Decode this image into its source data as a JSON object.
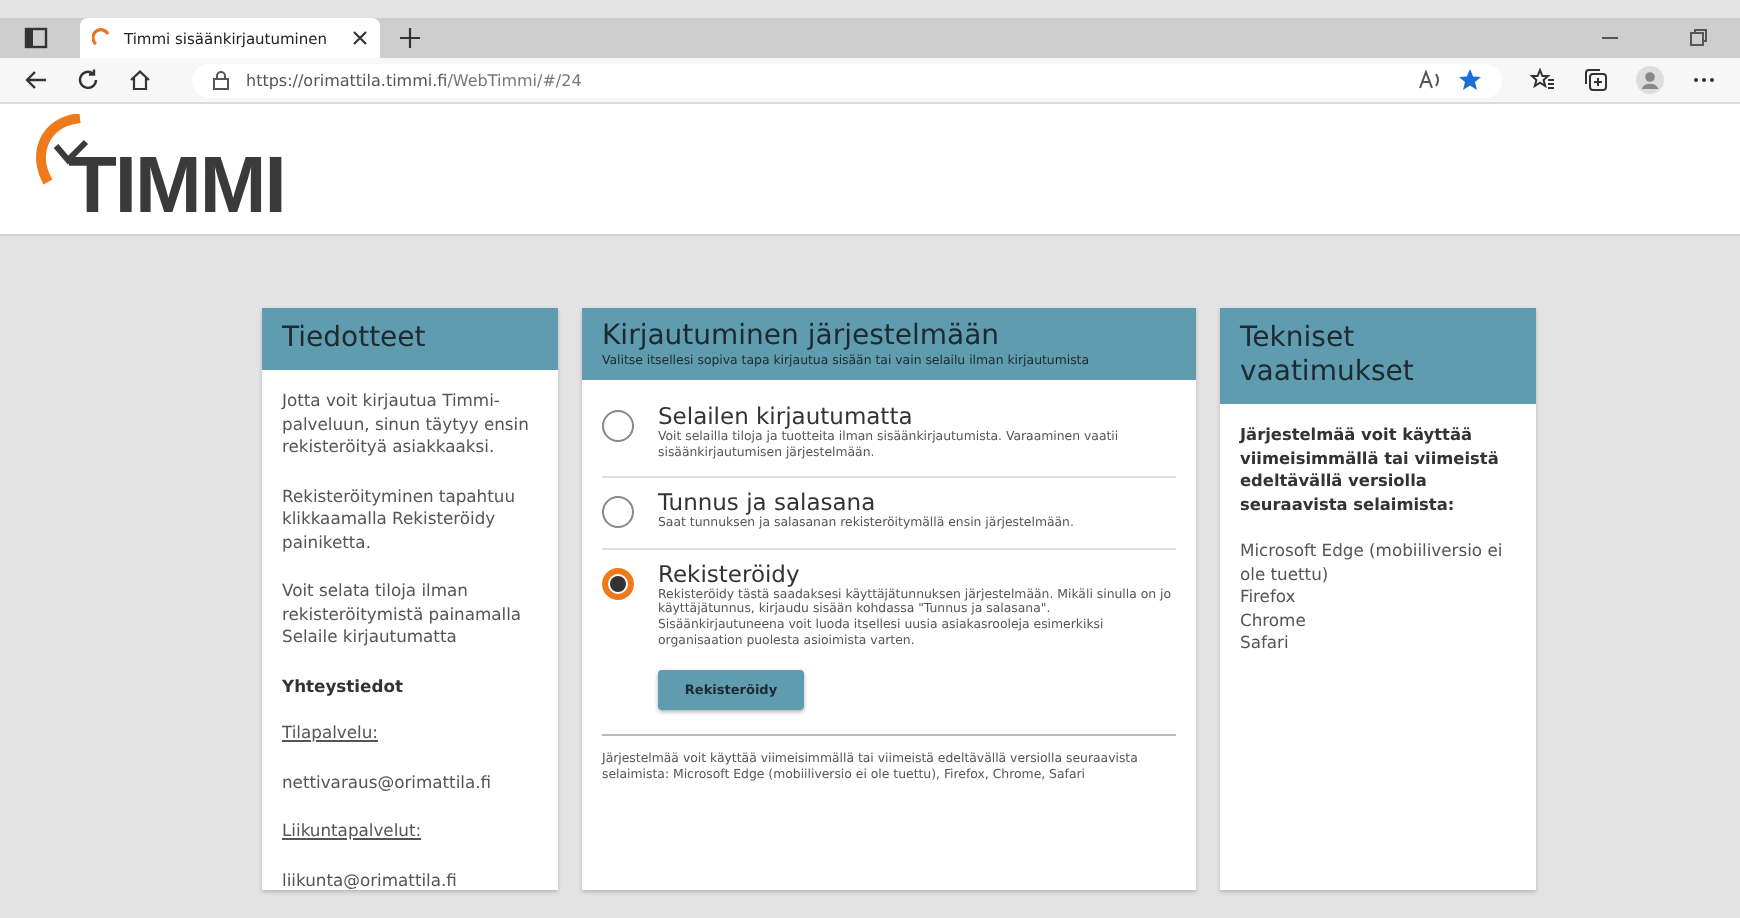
{
  "browser": {
    "tab_title": "Timmi sisäänkirjautuminen",
    "url_host": "https://orimattila.timmi.fi",
    "url_path": "/WebTimmi/#/24"
  },
  "logo": {
    "text": "TIMMI"
  },
  "news": {
    "title": "Tiedotteet",
    "items": [
      {
        "kind": "text",
        "text": "Jotta voit kirjautua Timmi-palveluun, sinun täytyy ensin rekisteröityä asiakkaaksi."
      },
      {
        "kind": "text",
        "text": "Rekisteröityminen tapahtuu klikkaamalla Rekisteröidy painiketta."
      },
      {
        "kind": "text",
        "text": "Voit selata tiloja ilman rekisteröitymistä painamalla Selaile kirjautumatta"
      },
      {
        "kind": "heading",
        "text": "Yhteystiedot"
      },
      {
        "kind": "link",
        "text": "Tilapalvelu:"
      },
      {
        "kind": "text",
        "text": "nettivaraus@orimattila.fi"
      },
      {
        "kind": "link",
        "text": "Liikuntapalvelut:"
      },
      {
        "kind": "text",
        "text": "liikunta@orimattila.fi"
      }
    ]
  },
  "login": {
    "title": "Kirjautuminen järjestelmään",
    "subtitle": "Valitse itsellesi sopiva tapa kirjautua sisään tai vain selailu ilman kirjautumista",
    "options": [
      {
        "title": "Selailen kirjautumatta",
        "description": "Voit selailla tiloja ja tuotteita ilman sisäänkirjautumista. Varaaminen vaatii sisäänkirjautumisen järjestelmään.",
        "selected": false
      },
      {
        "title": "Tunnus ja salasana",
        "description": "Saat tunnuksen ja salasanan rekisteröitymällä ensin järjestelmään.",
        "selected": false
      },
      {
        "title": "Rekisteröidy",
        "description": "Rekisteröidy tästä saadaksesi käyttäjätunnuksen järjestelmään. Mikäli sinulla on jo käyttäjätunnus, kirjaudu sisään kohdassa \"Tunnus ja salasana\". Sisäänkirjautuneena voit luoda itsellesi uusia asiakasrooleja esimerkiksi organisaation puolesta asioimista varten.",
        "selected": true,
        "button": "Rekisteröidy"
      }
    ],
    "note": "Järjestelmää voit käyttää viimeisimmällä tai viimeistä edeltävällä versiolla seuraavista selaimista: Microsoft Edge (mobiiliversio ei ole tuettu), Firefox, Chrome, Safari"
  },
  "requirements": {
    "title": "Tekniset vaatimukset",
    "intro": "Järjestelmää voit käyttää viimeisimmällä tai viimeistä edeltävällä versiolla seuraavista selaimista:",
    "browsers": [
      "Microsoft Edge (mobiiliversio ei ole tuettu)",
      "Firefox",
      "Chrome",
      "Safari"
    ]
  }
}
